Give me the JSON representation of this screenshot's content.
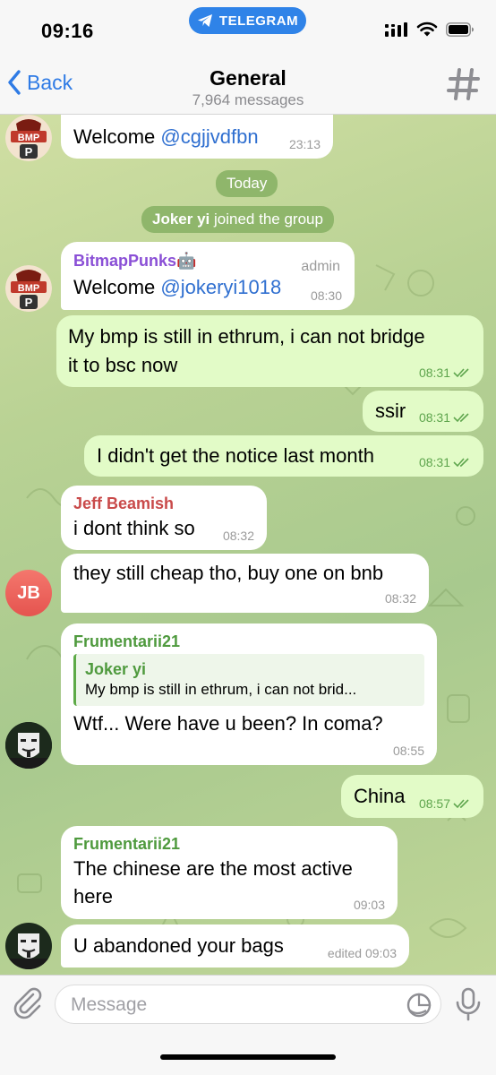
{
  "status": {
    "time": "09:16",
    "app_pill": "TELEGRAM"
  },
  "nav": {
    "back": "Back",
    "title": "General",
    "subtitle": "7,964 messages"
  },
  "date_pill": "Today",
  "service": {
    "name": "Joker yi",
    "text": "joined the group"
  },
  "messages": [
    {
      "sender": "",
      "text": "Welcome ",
      "link": "@cgjjvdfbn",
      "time": "23:13"
    },
    {
      "sender": "BitmapPunks🤖",
      "badge": "admin",
      "text": "Welcome ",
      "link": "@jokeryi1018",
      "time": "08:30"
    },
    {
      "line1": "My bmp is still in ethrum, i can not bridge",
      "line2": "it to bsc now",
      "time": "08:31"
    },
    {
      "text": "ssir",
      "time": "08:31"
    },
    {
      "text": "I didn't get the notice last month",
      "time": "08:31"
    },
    {
      "sender": "Jeff Beamish",
      "text": "i dont think so",
      "time": "08:32"
    },
    {
      "text": "they still cheap tho, buy one on bnb",
      "time": "08:32"
    },
    {
      "sender": "Frumentarii21",
      "quote_name": "Joker yi",
      "quote_text": "My bmp is still in ethrum, i can not brid...",
      "text": "Wtf... Were have u been? In coma?",
      "time": "08:55"
    },
    {
      "text": "China",
      "time": "08:57"
    },
    {
      "sender": "Frumentarii21",
      "line1": "The chinese are the most active",
      "line2": "here",
      "time": "09:03"
    },
    {
      "text": "U abandoned your bags",
      "time": "edited 09:03"
    }
  ],
  "avatars": {
    "jb": "JB",
    "bmp": "BMP",
    "bmp_letter": "P"
  },
  "input": {
    "placeholder": "Message"
  },
  "colors": {
    "accent": "#2f7be5",
    "jeff": "#c94a4a",
    "frumentarii": "#4f9a3e",
    "bitmap": "#8a4fd6"
  }
}
